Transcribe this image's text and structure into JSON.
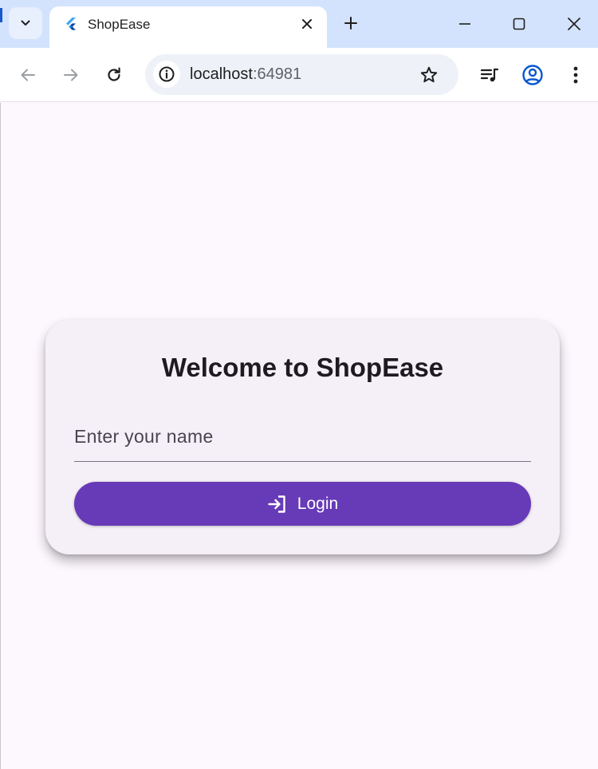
{
  "browser": {
    "tab": {
      "title": "ShopEase"
    },
    "address": {
      "host": "localhost",
      "port": ":64981"
    }
  },
  "page": {
    "welcome": "Welcome to ShopEase",
    "name_field": {
      "placeholder": "Enter your name",
      "value": ""
    },
    "login_button": {
      "label": "Login",
      "icon": "login-icon"
    }
  },
  "colors": {
    "titlebar": "#d3e3fd",
    "page_background": "#fdf7fe",
    "card": "#f5eff7",
    "primary": "#673ab7"
  }
}
